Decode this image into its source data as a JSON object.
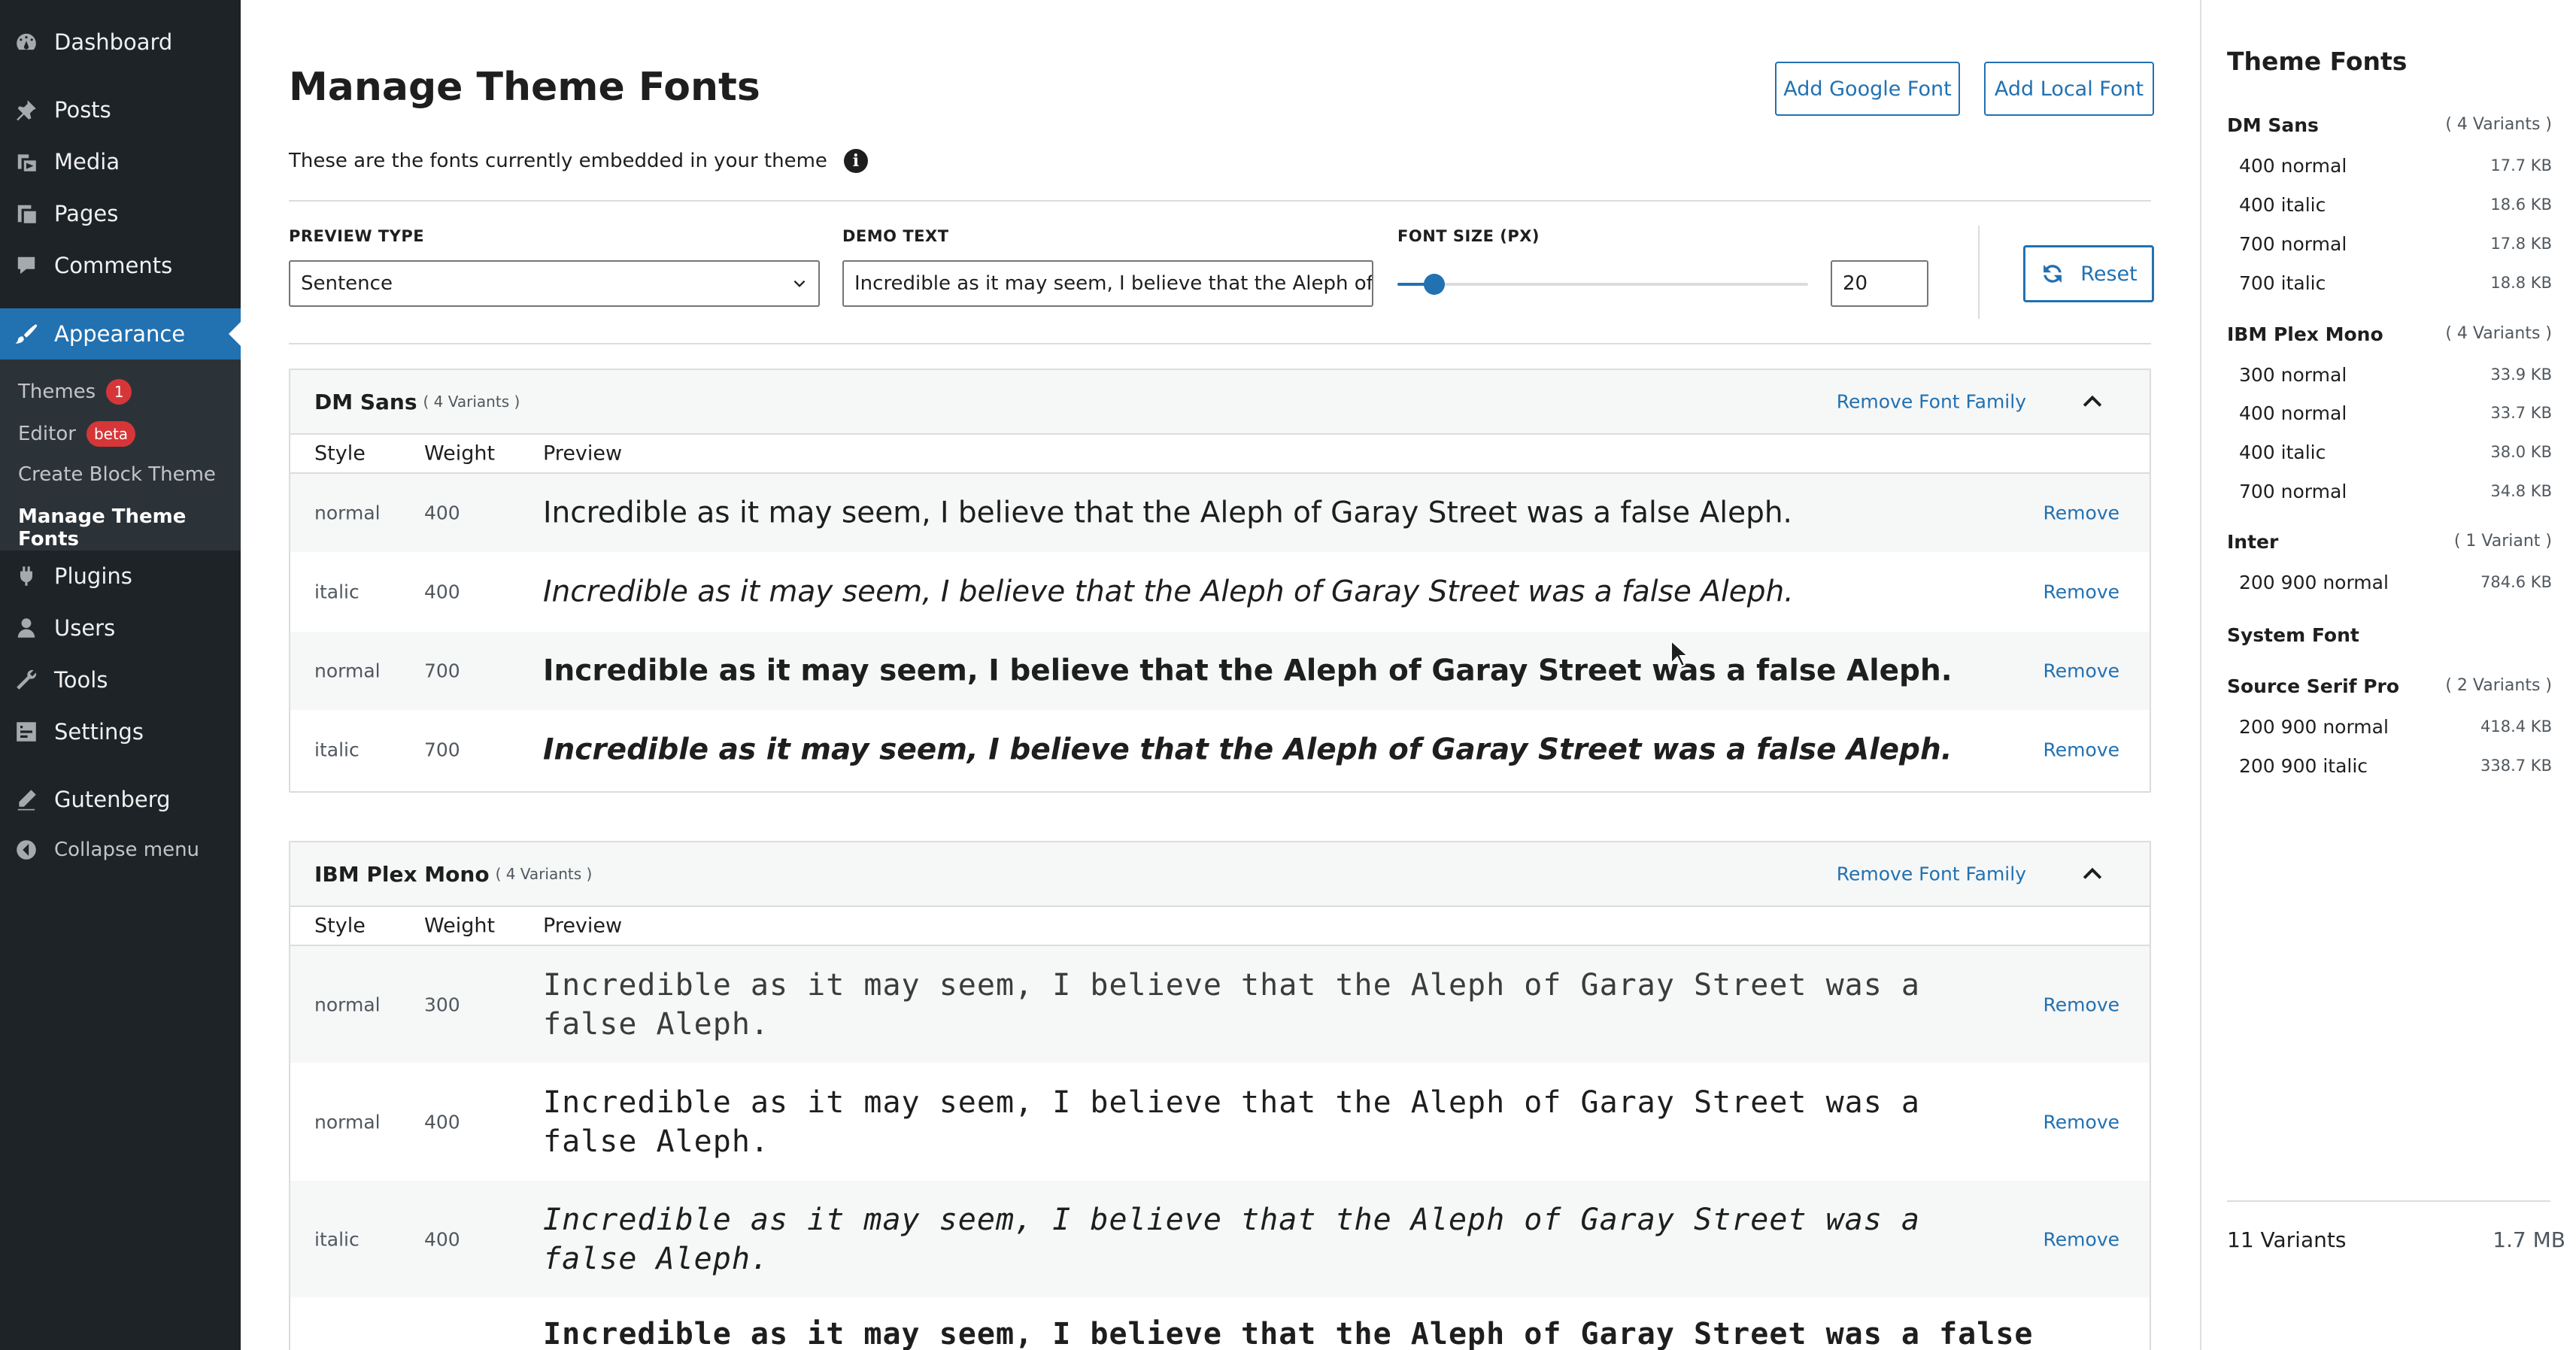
{
  "admin_menu": {
    "items": [
      {
        "label": "Dashboard",
        "icon": "dashboard-icon"
      },
      {
        "label": "Posts",
        "icon": "pin-icon"
      },
      {
        "label": "Media",
        "icon": "media-icon"
      },
      {
        "label": "Pages",
        "icon": "pages-icon"
      },
      {
        "label": "Comments",
        "icon": "comments-icon"
      },
      {
        "label": "Appearance",
        "icon": "brush-icon"
      },
      {
        "label": "Plugins",
        "icon": "plugin-icon"
      },
      {
        "label": "Users",
        "icon": "users-icon"
      },
      {
        "label": "Tools",
        "icon": "wrench-icon"
      },
      {
        "label": "Settings",
        "icon": "settings-icon"
      },
      {
        "label": "Gutenberg",
        "icon": "pencil-icon"
      },
      {
        "label": "Collapse menu",
        "icon": "collapse-icon"
      }
    ],
    "submenu": {
      "themes": "Themes",
      "themes_badge": "1",
      "editor": "Editor",
      "editor_badge": "beta",
      "create_block_theme": "Create Block Theme",
      "manage_theme_fonts": "Manage Theme Fonts"
    }
  },
  "header": {
    "title": "Manage Theme Fonts",
    "add_google_font": "Add Google Font",
    "add_local_font": "Add Local Font",
    "description": "These are the fonts currently embedded in your theme",
    "info_icon": "i"
  },
  "controls": {
    "preview_type_label": "PREVIEW TYPE",
    "preview_type_value": "Sentence",
    "demo_text_label": "DEMO TEXT",
    "demo_text_value": "Incredible as it may seem, I believe that the Aleph of Garay Street was a false Aleph.",
    "font_size_label": "FONT SIZE (PX)",
    "font_size_value": "20",
    "font_size_fraction": 0.09,
    "reset_label": "Reset"
  },
  "table_headers": {
    "style": "Style",
    "weight": "Weight",
    "preview": "Preview"
  },
  "families": [
    {
      "name": "DM Sans",
      "count": "( 4 Variants )",
      "remove_label": "Remove Font Family",
      "variants": [
        {
          "style": "normal",
          "weight": "400",
          "preview": "Incredible as it may seem, I believe that the Aleph of Garay Street was a false Aleph.",
          "remove": "Remove"
        },
        {
          "style": "italic",
          "weight": "400",
          "preview": "Incredible as it may seem, I believe that the Aleph of Garay Street was a false Aleph.",
          "remove": "Remove"
        },
        {
          "style": "normal",
          "weight": "700",
          "preview": "Incredible as it may seem, I believe that the Aleph of Garay Street was a false Aleph.",
          "remove": "Remove"
        },
        {
          "style": "italic",
          "weight": "700",
          "preview": "Incredible as it may seem, I believe that the Aleph of Garay Street was a false Aleph.",
          "remove": "Remove"
        }
      ]
    },
    {
      "name": "IBM Plex Mono",
      "count": "( 4 Variants )",
      "remove_label": "Remove Font Family",
      "variants": [
        {
          "style": "normal",
          "weight": "300",
          "preview": "Incredible as it may seem, I believe that the Aleph of Garay Street was a false Aleph.",
          "remove": "Remove"
        },
        {
          "style": "normal",
          "weight": "400",
          "preview": "Incredible as it may seem, I believe that the Aleph of Garay Street was a false Aleph.",
          "remove": "Remove"
        },
        {
          "style": "italic",
          "weight": "400",
          "preview": "Incredible as it may seem, I believe that the Aleph of Garay Street was a false Aleph.",
          "remove": "Remove"
        },
        {
          "style": "",
          "weight": "",
          "preview": "Incredible as it may seem, I believe that the Aleph of Garay Street was a false",
          "remove": ""
        }
      ]
    }
  ],
  "sidebar": {
    "title": "Theme Fonts",
    "families": [
      {
        "name": "DM Sans",
        "count": "( 4 Variants )",
        "variants": [
          {
            "label": "400 normal",
            "size": "17.7 KB"
          },
          {
            "label": "400 italic",
            "size": "18.6 KB"
          },
          {
            "label": "700 normal",
            "size": "17.8 KB"
          },
          {
            "label": "700 italic",
            "size": "18.8 KB"
          }
        ]
      },
      {
        "name": "IBM Plex Mono",
        "count": "( 4 Variants )",
        "variants": [
          {
            "label": "300 normal",
            "size": "33.9 KB"
          },
          {
            "label": "400 normal",
            "size": "33.7 KB"
          },
          {
            "label": "400 italic",
            "size": "38.0 KB"
          },
          {
            "label": "700 normal",
            "size": "34.8 KB"
          }
        ]
      },
      {
        "name": "Inter",
        "count": "( 1 Variant )",
        "variants": [
          {
            "label": "200 900 normal",
            "size": "784.6 KB"
          }
        ]
      },
      {
        "name": "System Font",
        "count": "",
        "variants": []
      },
      {
        "name": "Source Serif Pro",
        "count": "( 2 Variants )",
        "variants": [
          {
            "label": "200 900 normal",
            "size": "418.4 KB"
          },
          {
            "label": "200 900 italic",
            "size": "338.7 KB"
          }
        ]
      }
    ],
    "total_variants": "11 Variants",
    "total_size": "1.7 MB"
  },
  "colors": {
    "admin_bg": "#1d2327",
    "submenu_bg": "#2c3338",
    "accent": "#2271b1",
    "badge": "#d63638"
  }
}
